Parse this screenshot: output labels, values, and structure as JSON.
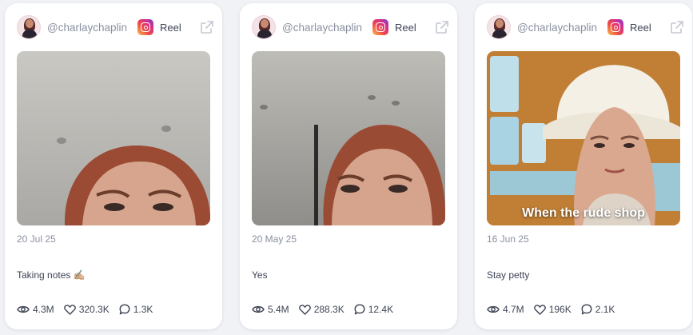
{
  "posts": [
    {
      "handle": "@charlaychaplin",
      "platform_icon": "instagram-icon",
      "type": "Reel",
      "date": "20 Jul 25",
      "caption": "Taking notes ✍🏼",
      "views": "4.3M",
      "likes": "320.3K",
      "comments": "1.3K"
    },
    {
      "handle": "@charlaychaplin",
      "platform_icon": "instagram-icon",
      "type": "Reel",
      "date": "20 May 25",
      "caption": "Yes",
      "views": "5.4M",
      "likes": "288.3K",
      "comments": "12.4K"
    },
    {
      "handle": "@charlaychaplin",
      "platform_icon": "instagram-icon",
      "type": "Reel",
      "date": "16 Jun 25",
      "caption": "Stay petty",
      "overlay_text": "When the rude shop",
      "views": "4.7M",
      "likes": "196K",
      "comments": "2.1K"
    }
  ],
  "colors": {
    "page_bg": "#f0f2f6",
    "card_bg": "#ffffff",
    "muted_text": "#8a90a0",
    "body_text": "#3d4454"
  }
}
